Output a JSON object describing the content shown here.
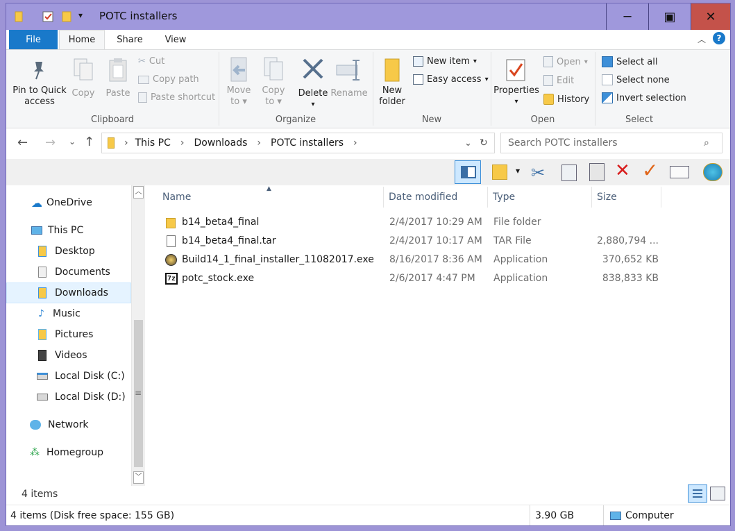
{
  "window": {
    "title": "POTC installers",
    "controls": {
      "minimize": "─",
      "maximize": "▣",
      "close": "✕"
    }
  },
  "ribbon": {
    "tabs": [
      "File",
      "Home",
      "Share",
      "View"
    ],
    "clipboard": {
      "pin_label_1": "Pin to Quick",
      "pin_label_2": "access",
      "copy": "Copy",
      "paste": "Paste",
      "cut": "Cut",
      "copy_path": "Copy path",
      "paste_shortcut": "Paste shortcut",
      "group_label": "Clipboard"
    },
    "organize": {
      "move_to_1": "Move",
      "move_to_2": "to",
      "copy_to_1": "Copy",
      "copy_to_2": "to",
      "delete": "Delete",
      "rename": "Rename",
      "group_label": "Organize"
    },
    "new": {
      "new_folder_1": "New",
      "new_folder_2": "folder",
      "new_item": "New item",
      "easy_access": "Easy access",
      "group_label": "New"
    },
    "open": {
      "properties": "Properties",
      "open": "Open",
      "edit": "Edit",
      "history": "History",
      "group_label": "Open"
    },
    "select": {
      "select_all": "Select all",
      "select_none": "Select none",
      "invert_selection": "Invert selection",
      "group_label": "Select"
    }
  },
  "address_bar": {
    "breadcrumbs": [
      "This PC",
      "Downloads",
      "POTC installers"
    ],
    "search_placeholder": "Search POTC installers"
  },
  "nav_pane": {
    "items": [
      "OneDrive",
      "This PC",
      "Desktop",
      "Documents",
      "Downloads",
      "Music",
      "Pictures",
      "Videos",
      "Local Disk (C:)",
      "Local Disk (D:)",
      "Network",
      "Homegroup"
    ]
  },
  "file_list": {
    "columns": [
      "Name",
      "Date modified",
      "Type",
      "Size"
    ],
    "rows": [
      {
        "name": "b14_beta4_final",
        "date": "2/4/2017 10:29 AM",
        "type": "File folder",
        "size": ""
      },
      {
        "name": "b14_beta4_final.tar",
        "date": "2/4/2017 10:17 AM",
        "type": "TAR File",
        "size": "2,880,794 ..."
      },
      {
        "name": "Build14_1_final_installer_11082017.exe",
        "date": "8/16/2017 8:36 AM",
        "type": "Application",
        "size": "370,652 KB"
      },
      {
        "name": "potc_stock.exe",
        "date": "2/6/2017 4:47 PM",
        "type": "Application",
        "size": "838,833 KB"
      }
    ]
  },
  "status": {
    "items_count": "4 items",
    "disk_info": "4 items (Disk free space: 155 GB)",
    "size": "3.90 GB",
    "location": "Computer"
  },
  "colors": {
    "title_bar": "#9f98dc",
    "file_tab": "#1979ca",
    "close": "#c4524a",
    "folder": "#f7c948"
  }
}
